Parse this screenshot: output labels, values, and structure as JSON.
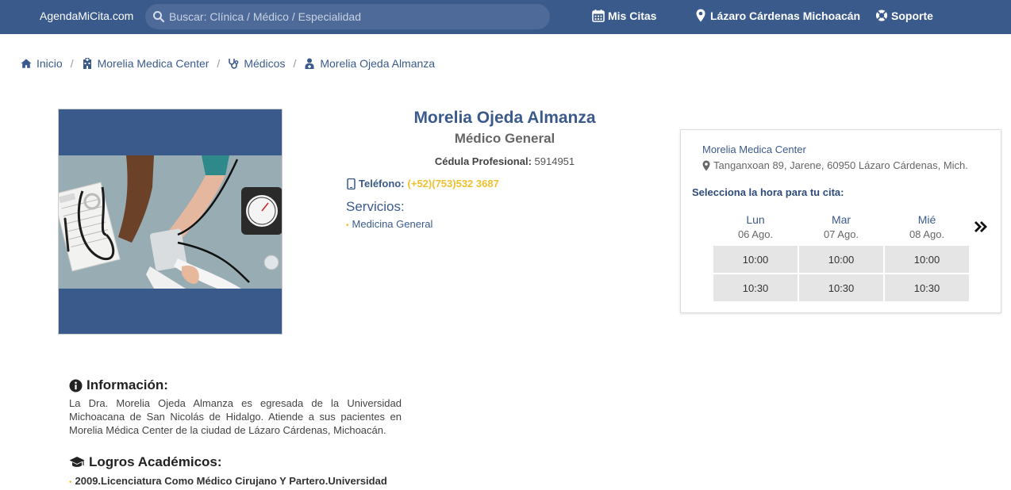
{
  "header": {
    "brand": "AgendaMiCita.com",
    "search_placeholder": "Buscar: Clínica / Médico / Especialidad",
    "mis_citas": "Mis Citas",
    "location": "Lázaro Cárdenas Michoacán",
    "soporte": "Soporte",
    "bg_color": "#3b5a8c"
  },
  "breadcrumb": [
    {
      "label": "Inicio",
      "icon": "home-icon"
    },
    {
      "label": "Morelia Medica Center",
      "icon": "hospital-icon"
    },
    {
      "label": "Médicos",
      "icon": "stethoscope-icon"
    },
    {
      "label": "Morelia Ojeda Almanza",
      "icon": "user-doctor-icon"
    }
  ],
  "doctor": {
    "name": "Morelia Ojeda Almanza",
    "specialty": "Médico General",
    "cedula_label": "Cédula Profesional:",
    "cedula_value": "5914951",
    "telefono_label": "Teléfono:",
    "telefono_value": "(+52)(753)532 3687",
    "servicios_title": "Servicios:",
    "servicios": [
      "Medicina General"
    ]
  },
  "appointment": {
    "clinic": "Morelia Medica Center",
    "address": "Tanganxoan 89, Jarene, 60950 Lázaro Cárdenas, Mich.",
    "prompt": "Selecciona la hora para tu cita:",
    "days": [
      {
        "name": "Lun",
        "date": "06 Ago.",
        "slots": [
          "10:00",
          "10:30"
        ]
      },
      {
        "name": "Mar",
        "date": "07 Ago.",
        "slots": [
          "10:00",
          "10:30"
        ]
      },
      {
        "name": "Mié",
        "date": "08 Ago.",
        "slots": [
          "10:00",
          "10:30"
        ]
      }
    ]
  },
  "info": {
    "title": "Información:",
    "text": "La Dra. Morelia Ojeda Almanza es egresada de la Universidad Michoacana de San Nicolás de Hidalgo. Atiende a sus pacientes en Morelia Médica Center de la ciudad de Lázaro Cárdenas, Michoacán."
  },
  "logros": {
    "title": "Logros Académicos:",
    "items": [
      "2009.Licenciatura Como Médico Cirujano Y Partero.Universidad"
    ]
  },
  "colors": {
    "primary": "#3b5a8c",
    "accent": "#f0c030"
  }
}
